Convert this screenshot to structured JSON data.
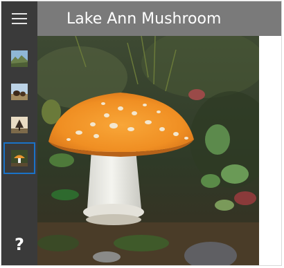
{
  "window": {
    "title": "Lake Ann Mushroom"
  },
  "nav": {
    "menu_icon": "hamburger-icon",
    "items": [
      {
        "icon": "landscape-thumbnail",
        "selected": false
      },
      {
        "icon": "bison-thumbnail",
        "selected": false
      },
      {
        "icon": "tree-thumbnail",
        "selected": false
      },
      {
        "icon": "mushroom-thumbnail",
        "selected": true
      }
    ],
    "help_label": "?"
  },
  "colors": {
    "nav_background": "#3a3a3a",
    "title_bar": "#7a7a7a",
    "selection_border": "#1a73c9",
    "title_text": "#ffffff"
  }
}
